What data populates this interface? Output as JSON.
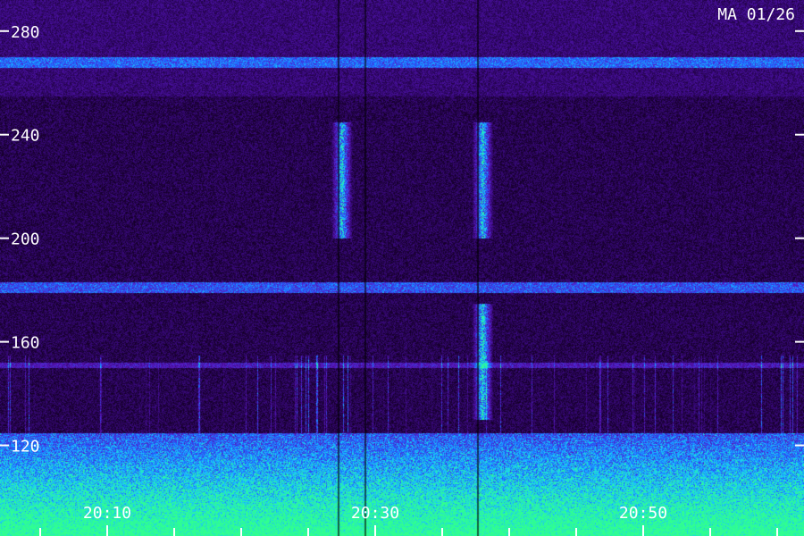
{
  "chart_data": {
    "type": "heatmap",
    "title": "",
    "stamp": "MA 01/26",
    "xlabel": "",
    "ylabel": "",
    "y_ticks": [
      280,
      240,
      200,
      160,
      120
    ],
    "ylim": [
      85,
      292
    ],
    "x_ticks": [
      "20:10",
      "20:30",
      "20:50"
    ],
    "x_tick_minutes": [
      10,
      30,
      50
    ],
    "xlim_minutes": [
      2,
      62
    ],
    "minor_tick_interval_minutes": 5,
    "grid": false,
    "colormap": [
      "#000000",
      "#1a0033",
      "#3a0a80",
      "#5a18c0",
      "#2060ff",
      "#18c8ff",
      "#30ff90"
    ],
    "features": {
      "persistent_bands": [
        {
          "freq_low": 266,
          "freq_high": 270,
          "intensity": 0.45
        },
        {
          "freq_low": 179,
          "freq_high": 183,
          "intensity": 0.5
        },
        {
          "freq_low": 150,
          "freq_high": 152,
          "intensity": 0.3
        }
      ],
      "noise_floor_freq": 125,
      "bursts": [
        {
          "minute": 27.5,
          "freq_low": 200,
          "freq_high": 245,
          "intensity": 0.85
        },
        {
          "minute": 38.0,
          "freq_low": 200,
          "freq_high": 245,
          "intensity": 0.85
        },
        {
          "minute": 38.0,
          "freq_low": 130,
          "freq_high": 175,
          "intensity": 0.9
        }
      ]
    }
  }
}
